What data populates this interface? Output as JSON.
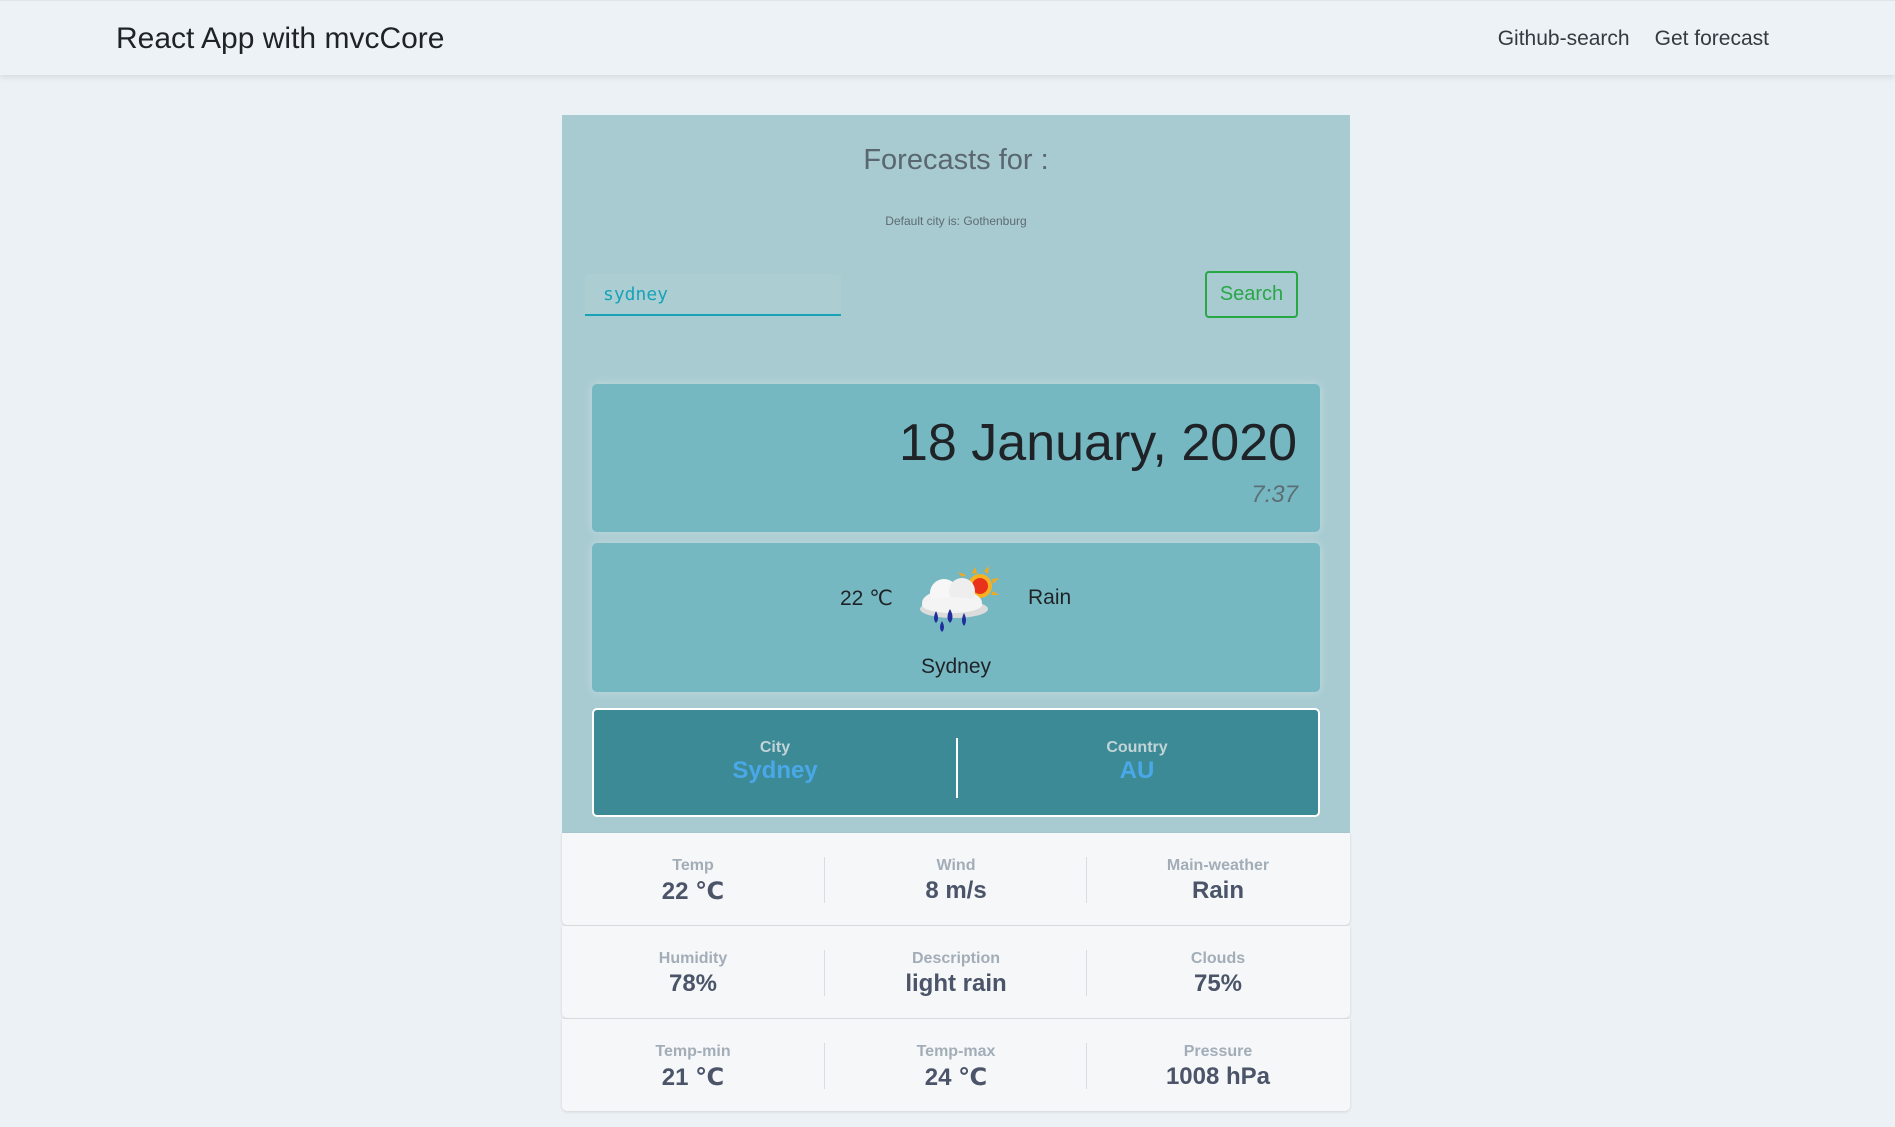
{
  "navbar": {
    "brand": "React App with mvcCore",
    "links": [
      "Github-search",
      "Get forecast"
    ]
  },
  "forecast": {
    "title": "Forecasts for :",
    "default_city_note": "Default city is: Gothenburg",
    "search_value": "sydney",
    "search_button": "Search"
  },
  "date_card": {
    "date": "18 January, 2020",
    "time": "7:37"
  },
  "weather_card": {
    "temp": "22 ℃",
    "icon": "rain-cloud-sun-icon",
    "main": "Rain",
    "city": "Sydney"
  },
  "location": {
    "city_label": "City",
    "city_value": "Sydney",
    "country_label": "Country",
    "country_value": "AU"
  },
  "stats": [
    [
      {
        "label": "Temp",
        "value": "22 ℃"
      },
      {
        "label": "Wind",
        "value": "8 m/s"
      },
      {
        "label": "Main-weather",
        "value": "Rain"
      }
    ],
    [
      {
        "label": "Humidity",
        "value": "78%"
      },
      {
        "label": "Description",
        "value": "light rain"
      },
      {
        "label": "Clouds",
        "value": "75%"
      }
    ],
    [
      {
        "label": "Temp-min",
        "value": "21 ℃"
      },
      {
        "label": "Temp-max",
        "value": "24 ℃"
      },
      {
        "label": "Pressure",
        "value": "1008 hPa"
      }
    ]
  ],
  "colors": {
    "page_bg": "#ecf1f5",
    "panel_bg": "#a7cbd1",
    "card_bg": "#76b8c2",
    "location_bg": "#3c8a96",
    "accent_blue": "#4aa8e8",
    "search_green": "#28a745",
    "input_teal": "#17a2b8"
  }
}
